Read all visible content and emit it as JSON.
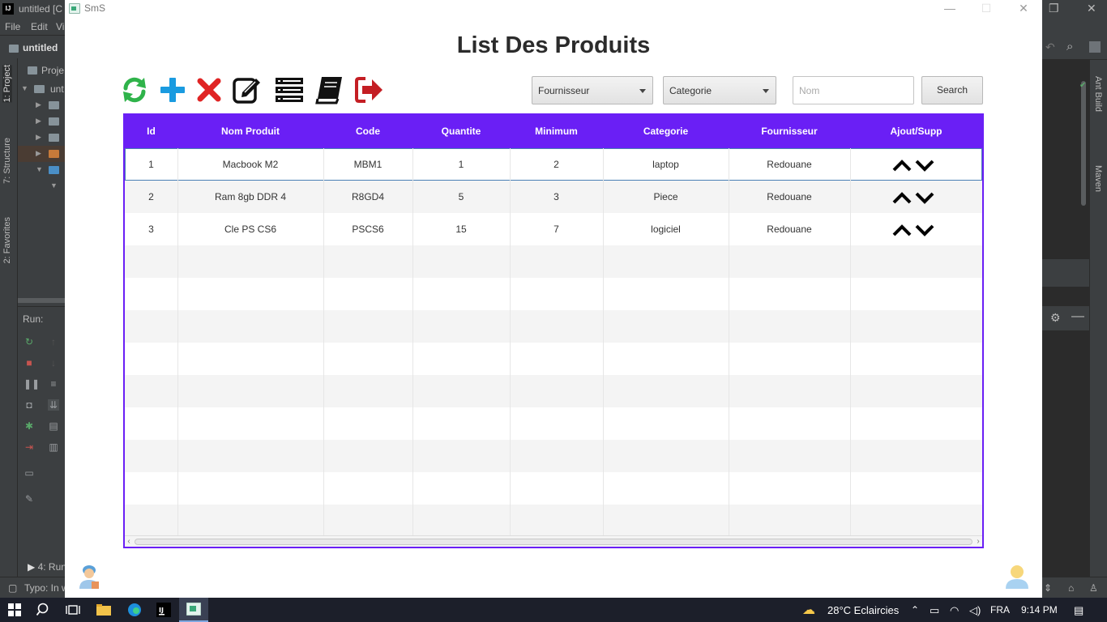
{
  "ide": {
    "title": "untitled [C",
    "menu": [
      "File",
      "Edit",
      "Vi"
    ],
    "project_name": "untitled",
    "project_header": "Proje",
    "tree_label": "unt",
    "left_tabs": [
      "1: Project",
      "7: Structure",
      "2: Favorites"
    ],
    "run_header": "Run:",
    "run_tab": "4: Run",
    "status_text": "Typo: In w",
    "right_tabs": [
      "Ant Build",
      "Maven"
    ],
    "win_restore": "❐",
    "win_close": "✕"
  },
  "app": {
    "window_title": "SmS",
    "page_title": "List Des Produits",
    "toolbar": {
      "icons": [
        "refresh-icon",
        "add-icon",
        "delete-icon",
        "edit-icon",
        "list-icon",
        "book-icon",
        "logout-icon"
      ],
      "colors": {
        "refresh": "#2fb34a",
        "add": "#1a9be0",
        "delete": "#e02424",
        "dark": "#111111",
        "logout": "#c41e24"
      }
    },
    "filters": {
      "fournisseur": "Fournisseur",
      "categorie": "Categorie",
      "search_placeholder": "Nom",
      "search_value": "",
      "search_button": "Search"
    },
    "table": {
      "headers": [
        "Id",
        "Nom Produit",
        "Code",
        "Quantite",
        "Minimum",
        "Categorie",
        "Fournisseur",
        "Ajout/Supp"
      ],
      "rows": [
        {
          "id": "1",
          "nom": "Macbook M2",
          "code": "MBM1",
          "quantite": "1",
          "minimum": "2",
          "categorie": "laptop",
          "fournisseur": "Redouane"
        },
        {
          "id": "2",
          "nom": "Ram 8gb DDR 4",
          "code": "R8GD4",
          "quantite": "5",
          "minimum": "3",
          "categorie": "Piece",
          "fournisseur": "Redouane"
        },
        {
          "id": "3",
          "nom": "Cle PS CS6",
          "code": "PSCS6",
          "quantite": "15",
          "minimum": "7",
          "categorie": "logiciel",
          "fournisseur": "Redouane"
        }
      ],
      "header_color": "#6a1ff5"
    }
  },
  "taskbar": {
    "weather": "28°C  Eclaircies",
    "lang": "FRA",
    "time": "9:14 PM"
  }
}
